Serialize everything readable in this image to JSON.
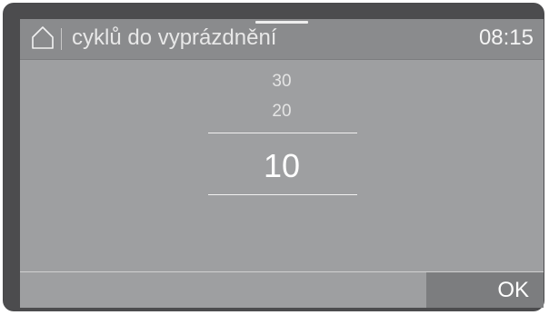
{
  "header": {
    "title": "cyklů do vyprázdnění",
    "clock": "08:15",
    "home_icon": "home-icon"
  },
  "picker": {
    "options_above": [
      "30",
      "20"
    ],
    "selected": "10"
  },
  "footer": {
    "ok_label": "OK"
  },
  "colors": {
    "bezel": "#4c4c4e",
    "screen": "#9e9fa1",
    "header": "#8a8b8d",
    "ok_button": "#7c7d7f",
    "text": "#ffffff"
  }
}
